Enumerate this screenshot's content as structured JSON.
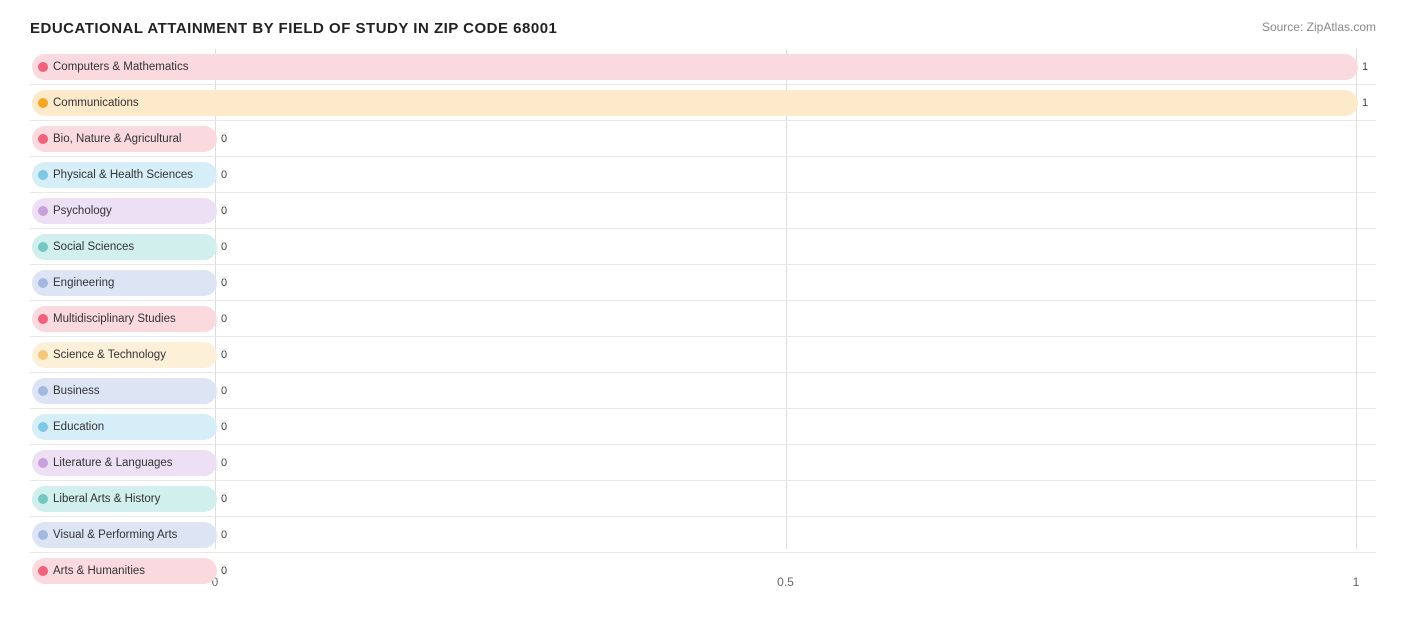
{
  "title": "EDUCATIONAL ATTAINMENT BY FIELD OF STUDY IN ZIP CODE 68001",
  "source": "Source: ZipAtlas.com",
  "bars": [
    {
      "label": "Computers & Mathematics",
      "value": 1,
      "color": "#F2607A",
      "pillBg": "#FADADF",
      "dotColor": "#F2607A"
    },
    {
      "label": "Communications",
      "value": 1,
      "color": "#F5A623",
      "pillBg": "#FDEACB",
      "dotColor": "#F5A623"
    },
    {
      "label": "Bio, Nature & Agricultural",
      "value": 0,
      "color": "#F2607A",
      "pillBg": "#FADADF",
      "dotColor": "#F2607A"
    },
    {
      "label": "Physical & Health Sciences",
      "value": 0,
      "color": "#7EC8E3",
      "pillBg": "#D6EEF7",
      "dotColor": "#7EC8E3"
    },
    {
      "label": "Psychology",
      "value": 0,
      "color": "#C9A0DC",
      "pillBg": "#EDE0F5",
      "dotColor": "#C9A0DC"
    },
    {
      "label": "Social Sciences",
      "value": 0,
      "color": "#74C8C0",
      "pillBg": "#D0EFED",
      "dotColor": "#74C8C0"
    },
    {
      "label": "Engineering",
      "value": 0,
      "color": "#A3B8E0",
      "pillBg": "#DDE5F5",
      "dotColor": "#A3B8E0"
    },
    {
      "label": "Multidisciplinary Studies",
      "value": 0,
      "color": "#F2607A",
      "pillBg": "#FADADF",
      "dotColor": "#F2607A"
    },
    {
      "label": "Science & Technology",
      "value": 0,
      "color": "#F5C77A",
      "pillBg": "#FDF0D9",
      "dotColor": "#F5C77A"
    },
    {
      "label": "Business",
      "value": 0,
      "color": "#A3B8E0",
      "pillBg": "#DDE5F5",
      "dotColor": "#A3B8E0"
    },
    {
      "label": "Education",
      "value": 0,
      "color": "#7EC8E3",
      "pillBg": "#D6EEF7",
      "dotColor": "#7EC8E3"
    },
    {
      "label": "Literature & Languages",
      "value": 0,
      "color": "#C9A0DC",
      "pillBg": "#EDE0F5",
      "dotColor": "#C9A0DC"
    },
    {
      "label": "Liberal Arts & History",
      "value": 0,
      "color": "#74C8C0",
      "pillBg": "#D0EFED",
      "dotColor": "#74C8C0"
    },
    {
      "label": "Visual & Performing Arts",
      "value": 0,
      "color": "#A3B8E0",
      "pillBg": "#DDE5F5",
      "dotColor": "#A3B8E0"
    },
    {
      "label": "Arts & Humanities",
      "value": 0,
      "color": "#F2607A",
      "pillBg": "#FADADF",
      "dotColor": "#F2607A"
    }
  ],
  "xAxis": {
    "min": 0,
    "max": 1,
    "ticks": [
      {
        "value": 0,
        "label": "0"
      },
      {
        "value": 0.5,
        "label": "0.5"
      },
      {
        "value": 1,
        "label": "1"
      }
    ]
  }
}
